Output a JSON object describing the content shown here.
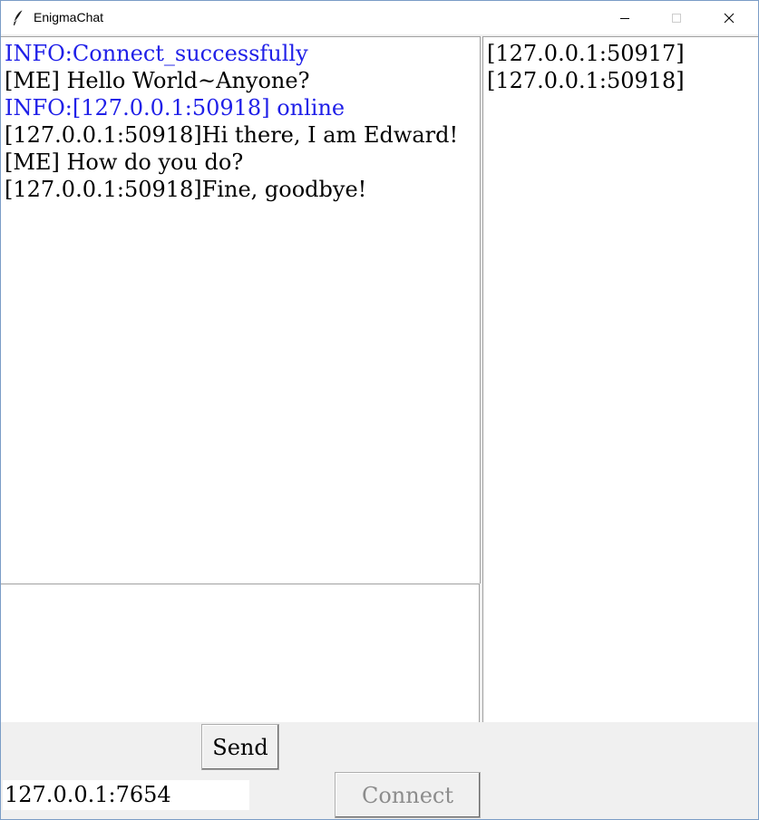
{
  "window": {
    "title": "EnigmaChat",
    "icons": {
      "app": "feather-icon",
      "minimize": "minimize-icon",
      "maximize": "maximize-icon",
      "close": "close-icon"
    }
  },
  "chat": {
    "lines": [
      {
        "text": "INFO:Connect_successfully",
        "type": "info"
      },
      {
        "text": "[ME] Hello World~Anyone?",
        "type": "normal"
      },
      {
        "text": "INFO:[127.0.0.1:50918] online",
        "type": "info"
      },
      {
        "text": "[127.0.0.1:50918]Hi there, I am Edward!",
        "type": "normal"
      },
      {
        "text": "[ME] How do you do?",
        "type": "normal"
      },
      {
        "text": "[127.0.0.1:50918]Fine, goodbye!",
        "type": "normal"
      }
    ],
    "colors": {
      "info": "#2020e8",
      "normal": "#000000"
    }
  },
  "message_input": {
    "value": ""
  },
  "online_users": {
    "items": [
      "[127.0.0.1:50917]",
      "[127.0.0.1:50918]"
    ]
  },
  "controls": {
    "send_label": "Send",
    "address_value": "127.0.0.1:7654",
    "connect_label": "Connect",
    "connect_disabled": true
  }
}
